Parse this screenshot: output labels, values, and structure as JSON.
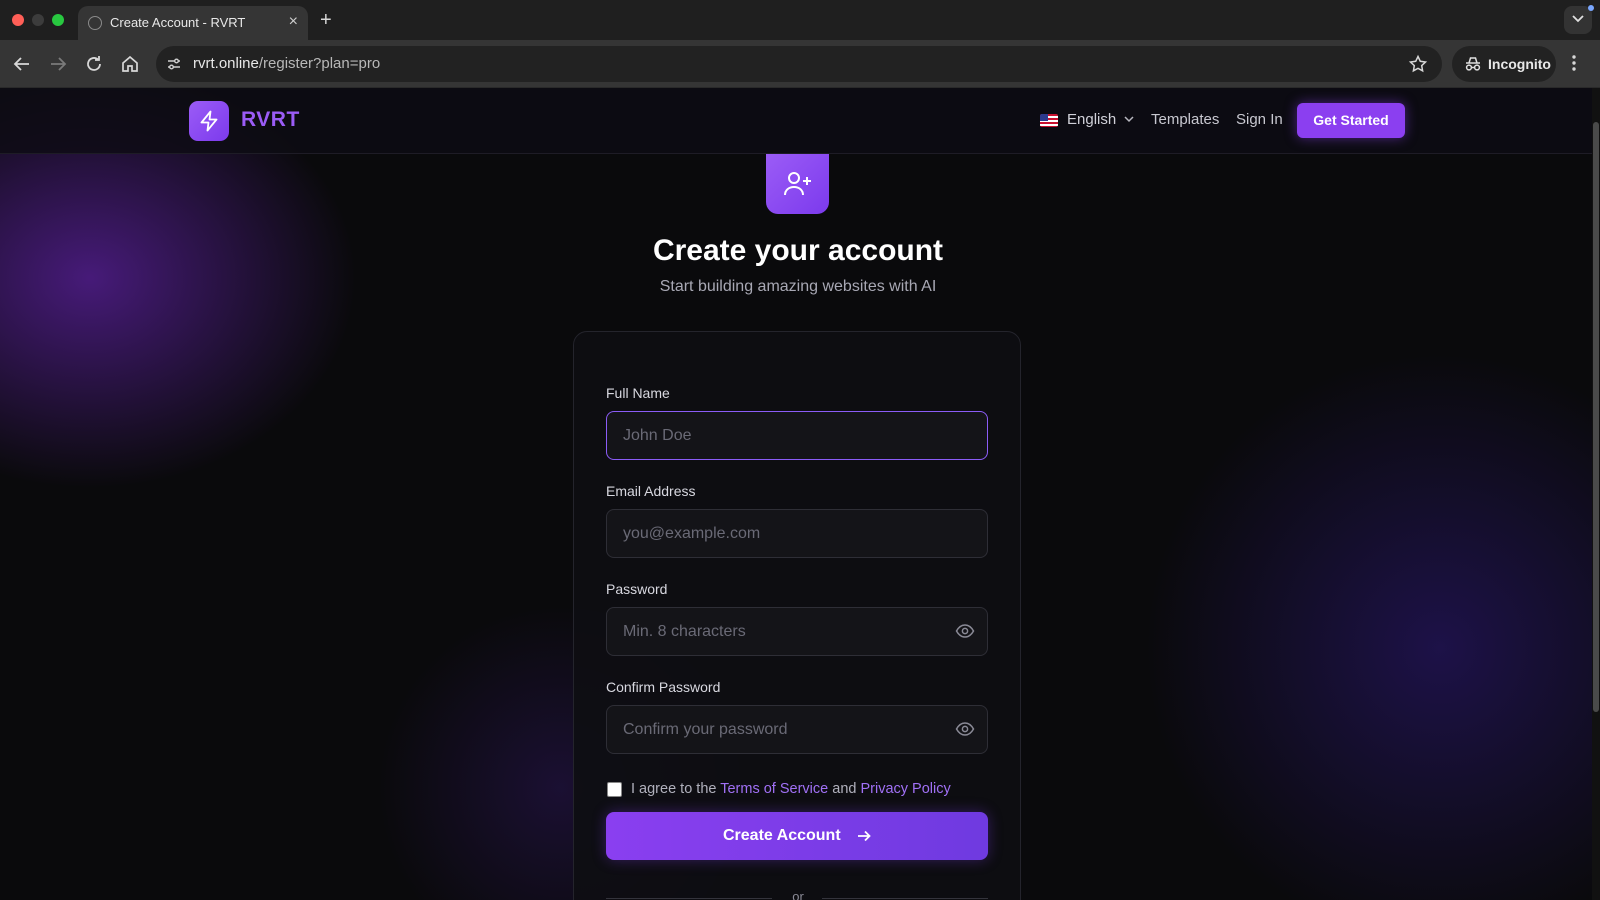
{
  "browser": {
    "tab_title": "Create Account - RVRT",
    "url_host": "rvrt.online",
    "url_path": "/register?plan=pro",
    "incognito_label": "Incognito"
  },
  "header": {
    "brand": "RVRT",
    "language": "English",
    "nav": {
      "templates": "Templates",
      "sign_in": "Sign In",
      "cta": "Get Started"
    }
  },
  "hero": {
    "icon": "user-plus-icon",
    "title": "Create your account",
    "subtitle": "Start building amazing websites with AI"
  },
  "form": {
    "full_name": {
      "label": "Full Name",
      "placeholder": "John Doe",
      "value": ""
    },
    "email": {
      "label": "Email Address",
      "placeholder": "you@example.com",
      "value": ""
    },
    "password": {
      "label": "Password",
      "placeholder": "Min. 8 characters",
      "value": ""
    },
    "confirm_password": {
      "label": "Confirm Password",
      "placeholder": "Confirm your password",
      "value": ""
    },
    "agree_prefix": "I agree to the",
    "terms_link": "Terms of Service",
    "agree_and": "and",
    "privacy_link": "Privacy Policy",
    "agree_checked": false,
    "submit_label": "Create Account",
    "divider": "or"
  },
  "colors": {
    "accent": "#8b3ff0",
    "brand_text": "#9b5cf6",
    "background": "#0a0a0c"
  }
}
